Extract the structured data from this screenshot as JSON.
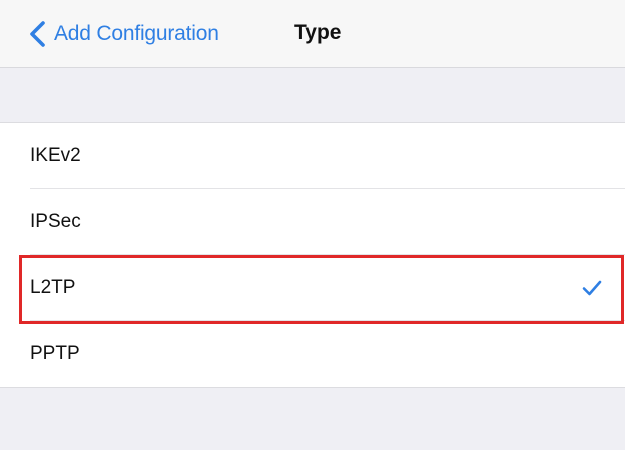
{
  "nav": {
    "back_label": "Add Configuration",
    "title": "Type"
  },
  "types": [
    {
      "label": "IKEv2",
      "selected": false
    },
    {
      "label": "IPSec",
      "selected": false
    },
    {
      "label": "L2TP",
      "selected": true
    },
    {
      "label": "PPTP",
      "selected": false
    }
  ],
  "colors": {
    "accent": "#2f7fe3",
    "highlight": "#e02828",
    "background": "#efeff4"
  },
  "icons": {
    "back": "chevron-left-icon",
    "selected": "checkmark-icon"
  }
}
